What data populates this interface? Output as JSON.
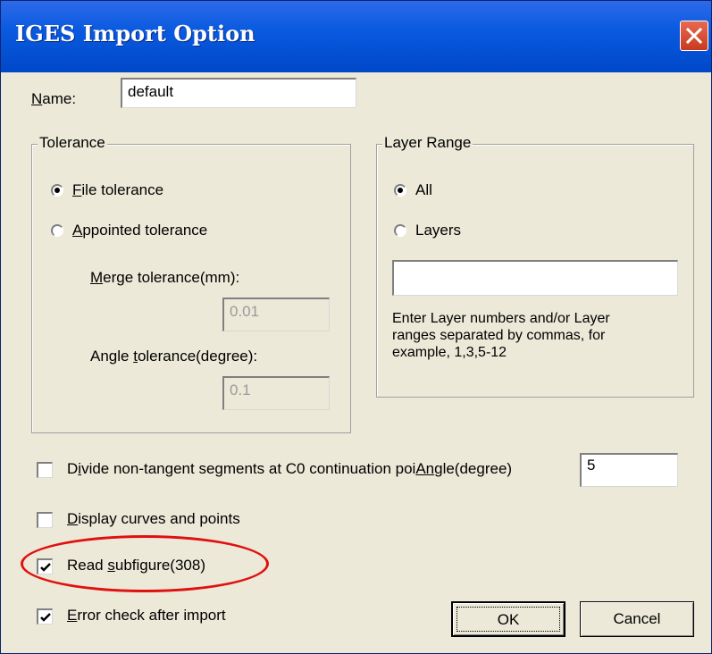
{
  "window": {
    "title": "IGES Import Option"
  },
  "name_field": {
    "label_accel": "N",
    "label_rest": "ame:",
    "value": "default"
  },
  "tolerance": {
    "group_title": "Tolerance",
    "file_tolerance": {
      "accel": "F",
      "rest": "ile tolerance",
      "selected": true
    },
    "appointed_tolerance": {
      "accel": "A",
      "rest": "ppointed tolerance",
      "selected": false
    },
    "merge": {
      "accel": "M",
      "rest": "erge tolerance(mm):",
      "value": "0.01"
    },
    "angle": {
      "pre": "Angle ",
      "accel": "t",
      "rest": "olerance(degree):",
      "value": "0.1"
    }
  },
  "layer_range": {
    "group_title": "Layer Range",
    "all": {
      "label": "All",
      "selected": true
    },
    "layers": {
      "label": "Layers",
      "selected": false
    },
    "input_value": "",
    "help_lines": [
      "Enter Layer numbers and/or Layer",
      "ranges separated by commas, for",
      "example, 1,3,5-12"
    ]
  },
  "options": {
    "divide": {
      "pre": "D",
      "accel": "i",
      "rest": "vide non-tangent segments at C0 continuation poi",
      "checked": false
    },
    "divide_angle": {
      "pre": "A",
      "accel": "n",
      "rest": "gle(degree)",
      "value": "5"
    },
    "display": {
      "accel": "D",
      "rest": "isplay curves and points",
      "checked": false
    },
    "read_subfigure": {
      "pre": "Read ",
      "accel": "s",
      "rest": "ubfigure(308)",
      "checked": true
    },
    "error_check": {
      "accel": "E",
      "rest": "rror check after import",
      "checked": true
    }
  },
  "buttons": {
    "ok": "OK",
    "cancel": "Cancel"
  },
  "colors": {
    "title_bar": "#0A5AE0",
    "dialog_bg": "#ECE9D8",
    "highlight_ellipse": "#E01010",
    "close_button": "#C83A20"
  }
}
